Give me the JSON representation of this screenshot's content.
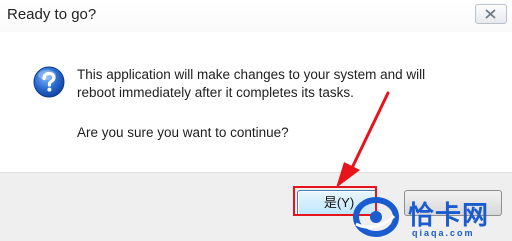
{
  "window": {
    "title": "Ready to go?"
  },
  "message": {
    "line1": "This application will make changes to your system and will",
    "line2": "reboot immediately after it completes its tasks.",
    "question": "Are you sure you want to continue?"
  },
  "buttons": {
    "yes_label": "是(Y)",
    "no_label": ""
  },
  "icons": {
    "dialog_icon": "question-icon",
    "close": "close-icon"
  },
  "annotation": {
    "highlight_color": "#e8141c"
  },
  "watermark": {
    "brand": "恰卡网",
    "url": "qiaqa.com"
  }
}
